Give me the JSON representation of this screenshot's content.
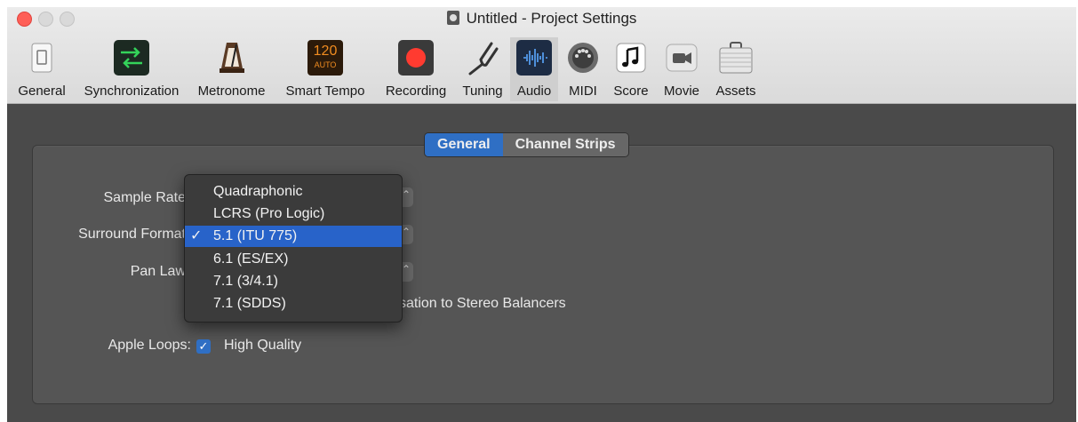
{
  "window": {
    "title": "Untitled - Project Settings"
  },
  "toolbar": {
    "items": [
      {
        "label": "General",
        "icon": "switch-icon"
      },
      {
        "label": "Synchronization",
        "icon": "sync-arrows-icon"
      },
      {
        "label": "Metronome",
        "icon": "metronome-icon"
      },
      {
        "label": "Smart Tempo",
        "icon": "tempo-display-icon",
        "badge_top": "120",
        "badge_bottom": "AUTO"
      },
      {
        "label": "Recording",
        "icon": "record-icon"
      },
      {
        "label": "Tuning",
        "icon": "tuning-fork-icon"
      },
      {
        "label": "Audio",
        "icon": "waveform-icon",
        "active": true
      },
      {
        "label": "MIDI",
        "icon": "midi-port-icon"
      },
      {
        "label": "Score",
        "icon": "music-note-icon"
      },
      {
        "label": "Movie",
        "icon": "camera-icon"
      },
      {
        "label": "Assets",
        "icon": "briefcase-icon"
      }
    ]
  },
  "tabs": [
    {
      "label": "General",
      "selected": true
    },
    {
      "label": "Channel Strips",
      "selected": false
    }
  ],
  "form": {
    "sample_rate_label": "Sample Rate",
    "surround_format_label": "Surround Format",
    "pan_law_label": "Pan Law",
    "compensation_text": "sation to Stereo Balancers",
    "apple_loops_label": "Apple Loops:",
    "high_quality_label": "High Quality",
    "high_quality_checked": true
  },
  "surround_menu": {
    "items": [
      {
        "label": "Quadraphonic",
        "checked": false
      },
      {
        "label": "LCRS (Pro Logic)",
        "checked": false
      },
      {
        "label": "5.1 (ITU 775)",
        "checked": true
      },
      {
        "label": "6.1 (ES/EX)",
        "checked": false
      },
      {
        "label": "7.1 (3/4.1)",
        "checked": false
      },
      {
        "label": "7.1 (SDDS)",
        "checked": false
      }
    ],
    "check_mark": "✓"
  },
  "colors": {
    "accent": "#2f6fc4",
    "menu_highlight": "#2863c9",
    "close": "#fe5f57",
    "record": "#ff3b30"
  }
}
